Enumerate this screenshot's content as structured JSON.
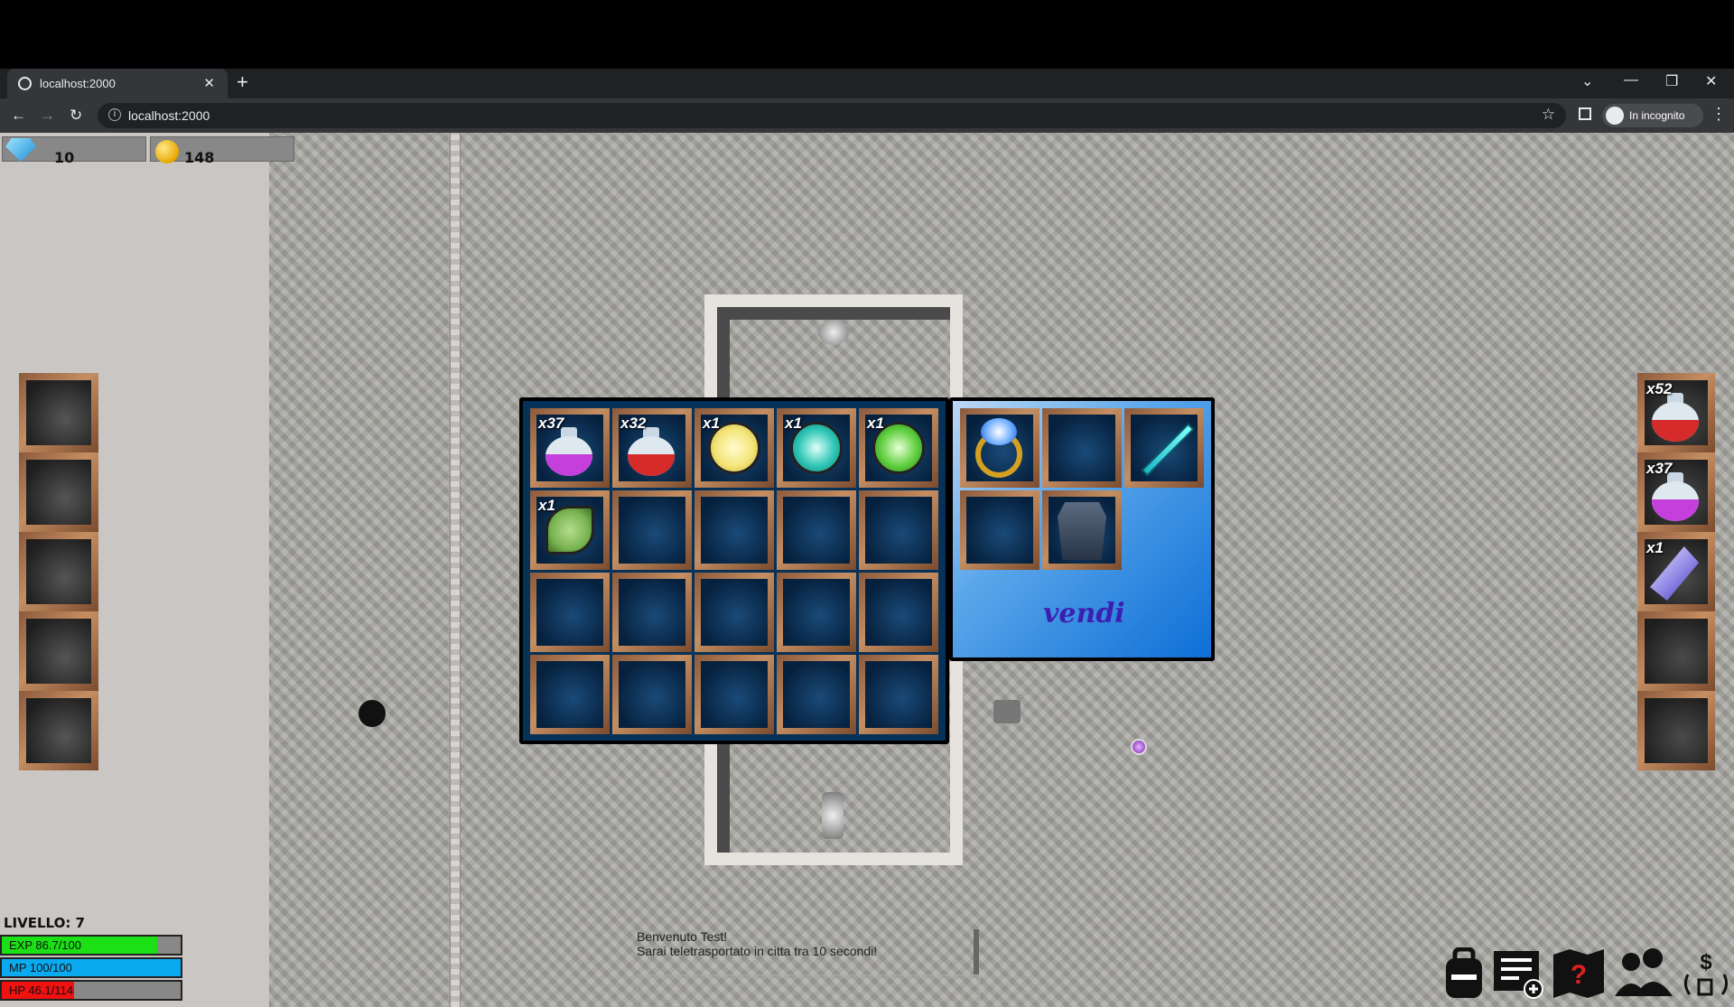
{
  "browser": {
    "tab_title": "localhost:2000",
    "tab_close": "✕",
    "new_tab": "+",
    "url": "localhost:2000",
    "incognito_label": "In incognito"
  },
  "currency": {
    "gems": "10",
    "gold": "148"
  },
  "inventory": {
    "rows": [
      [
        {
          "qty": "x37",
          "icon": "purple-potion-icon",
          "color": "#c53fdc"
        },
        {
          "qty": "x32",
          "icon": "red-potion-icon",
          "color": "#d62b2b"
        },
        {
          "qty": "x1",
          "icon": "yellow-gem-icon",
          "color": "#f4e57a"
        },
        {
          "qty": "x1",
          "icon": "cyan-gem-icon",
          "color": "#2fc6b6"
        },
        {
          "qty": "x1",
          "icon": "green-gem-icon",
          "color": "#5fcf3f"
        }
      ],
      [
        {
          "qty": "x1",
          "icon": "leaf-icon",
          "color": "#7ab552"
        }
      ]
    ]
  },
  "shop": {
    "items": [
      {
        "icon": "ring-icon"
      },
      {
        "icon": ""
      },
      {
        "icon": "sword-icon"
      },
      {
        "icon": ""
      },
      {
        "icon": "armor-icon"
      }
    ],
    "sell_label": "vendi"
  },
  "hotbar": [
    {
      "qty": "x52",
      "icon": "red-potion-icon",
      "color": "#d62b2b"
    },
    {
      "qty": "x37",
      "icon": "purple-potion-icon",
      "color": "#c53fdc"
    },
    {
      "qty": "x1",
      "icon": "crystal-icon"
    }
  ],
  "stats": {
    "level": "LIVELLO: 7",
    "exp": "EXP 86.7/100",
    "exp_fraction": 0.867,
    "mp": "MP 100/100",
    "mp_fraction": 1.0,
    "hp": "HP 46.1/114",
    "hp_fraction": 0.404
  },
  "chat": {
    "line1": "Benvenuto Test!",
    "line2": "Sarai teletrasportato in citta tra 10 secondi!"
  },
  "hud_buttons": [
    "backpack-icon",
    "quests-icon",
    "map-help-icon",
    "party-icon",
    "shop-icon"
  ]
}
